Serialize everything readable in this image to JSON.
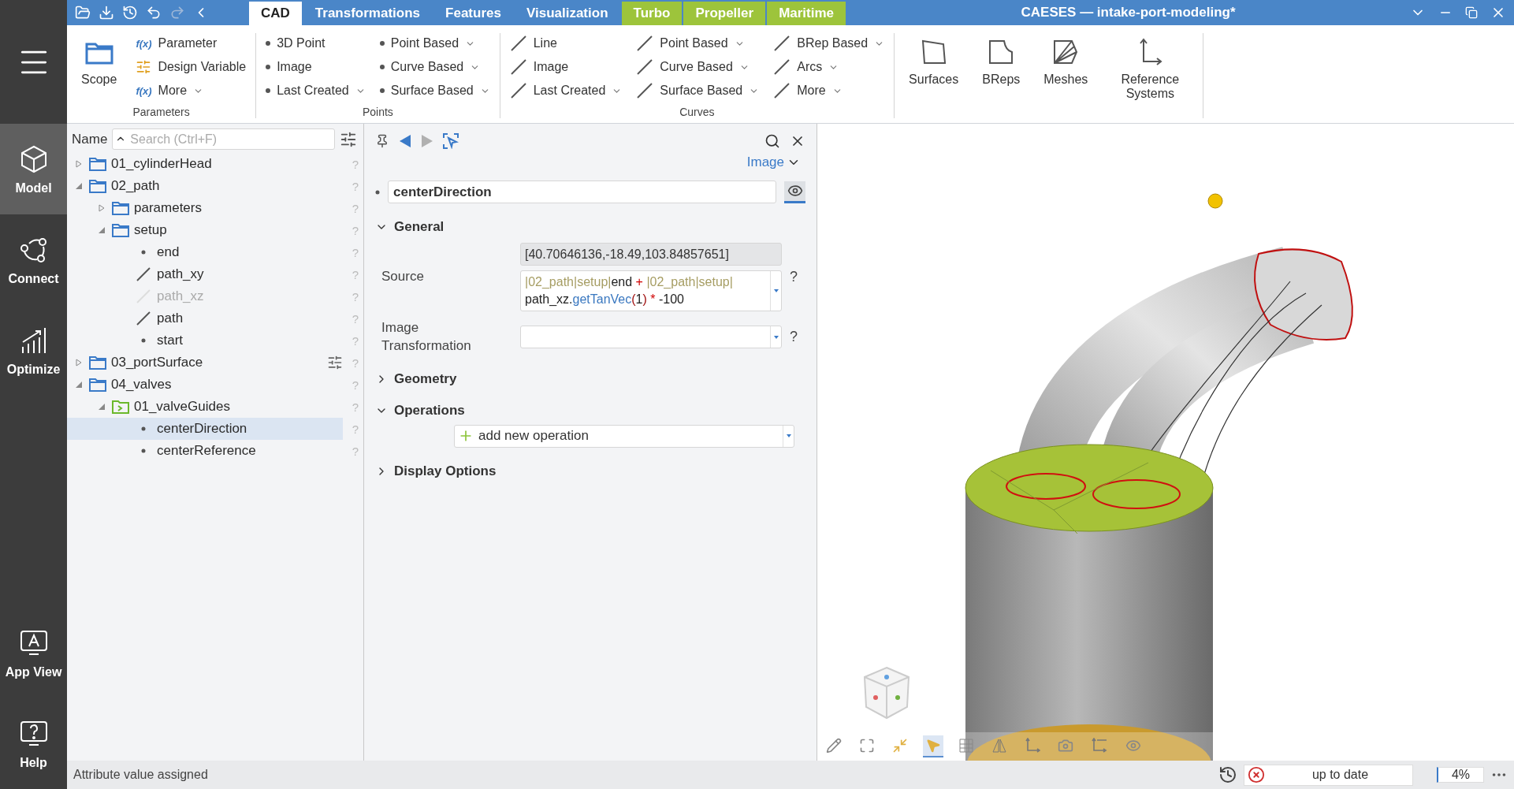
{
  "window": {
    "title": "CAESES — intake-port-modeling*"
  },
  "quick_actions": [
    {
      "kind": "open",
      "disabled": false
    },
    {
      "kind": "save",
      "disabled": false
    },
    {
      "kind": "history",
      "disabled": false
    },
    {
      "kind": "undo",
      "disabled": false
    },
    {
      "kind": "redo",
      "disabled": true
    },
    {
      "kind": "back",
      "disabled": false
    }
  ],
  "tabs": [
    {
      "label": "CAD",
      "selected": true,
      "kind": "core"
    },
    {
      "label": "Transformations",
      "selected": false,
      "kind": "core"
    },
    {
      "label": "Features",
      "selected": false,
      "kind": "core"
    },
    {
      "label": "Visualization",
      "selected": false,
      "kind": "core"
    },
    {
      "label": "Turbo",
      "selected": false,
      "kind": "addon"
    },
    {
      "label": "Propeller",
      "selected": false,
      "kind": "addon"
    },
    {
      "label": "Maritime",
      "selected": false,
      "kind": "addon"
    }
  ],
  "ribbon_groups": [
    {
      "label": "Parameters",
      "large": [
        {
          "label": "Scope",
          "kind": "folder"
        }
      ],
      "columns": [
        [
          {
            "label": "Parameter",
            "kind": "function",
            "prefix": "f(x)",
            "dropdown": false
          },
          {
            "label": "Design Variable",
            "kind": "slider",
            "dropdown": false
          },
          {
            "label": "More",
            "kind": "function",
            "prefix": "f(x)",
            "dropdown": true
          }
        ]
      ]
    },
    {
      "label": "Points",
      "columns": [
        [
          {
            "label": "3D Point",
            "kind": "point",
            "dropdown": false
          },
          {
            "label": "Image",
            "kind": "point",
            "dropdown": false
          },
          {
            "label": "Last Created",
            "kind": "point",
            "dropdown": true
          }
        ],
        [
          {
            "label": "Point Based",
            "kind": "point",
            "dropdown": true
          },
          {
            "label": "Curve Based",
            "kind": "point",
            "dropdown": true
          },
          {
            "label": "Surface Based",
            "kind": "point",
            "dropdown": true
          }
        ]
      ]
    },
    {
      "label": "Curves",
      "columns": [
        [
          {
            "label": "Line",
            "kind": "line",
            "dropdown": false
          },
          {
            "label": "Image",
            "kind": "line",
            "dropdown": false
          },
          {
            "label": "Last Created",
            "kind": "line",
            "dropdown": true
          }
        ],
        [
          {
            "label": "Point Based",
            "kind": "line",
            "dropdown": true
          },
          {
            "label": "Curve Based",
            "kind": "line",
            "dropdown": true
          },
          {
            "label": "Surface Based",
            "kind": "line",
            "dropdown": true
          }
        ],
        [
          {
            "label": "BRep Based",
            "kind": "line",
            "dropdown": true
          },
          {
            "label": "Arcs",
            "kind": "line",
            "dropdown": true
          },
          {
            "label": "More",
            "kind": "line",
            "dropdown": true
          }
        ]
      ]
    },
    {
      "large": [
        {
          "label": "Surfaces",
          "kind": "surface"
        },
        {
          "label": "BReps",
          "kind": "brep"
        },
        {
          "label": "Meshes",
          "kind": "mesh"
        },
        {
          "label": "Reference Systems",
          "kind": "axes"
        }
      ]
    }
  ],
  "nav_top": [
    {
      "label": "Model",
      "kind": "cube",
      "selected": true
    },
    {
      "label": "Connect",
      "kind": "network",
      "selected": false
    },
    {
      "label": "Optimize",
      "kind": "chart",
      "selected": false
    }
  ],
  "nav_bottom": [
    {
      "label": "App View",
      "kind": "appview",
      "selected": false
    },
    {
      "label": "Help",
      "kind": "help",
      "selected": false
    }
  ],
  "tree": {
    "header": "Name",
    "search_placeholder": "Search (Ctrl+F)",
    "items": [
      {
        "label": "01_cylinderHead",
        "kind": "folder",
        "expanded": false,
        "selected": false,
        "help": "?"
      },
      {
        "label": "02_path",
        "kind": "folder",
        "expanded": true,
        "selected": false,
        "help": "?",
        "children": [
          {
            "label": "parameters",
            "kind": "folder",
            "expanded": false,
            "selected": false,
            "help": "?"
          },
          {
            "label": "setup",
            "kind": "folder",
            "expanded": true,
            "selected": false,
            "help": "?",
            "children": [
              {
                "label": "end",
                "kind": "point",
                "selected": false,
                "disabled": false,
                "help": "?"
              },
              {
                "label": "path_xy",
                "kind": "curve",
                "selected": false,
                "disabled": false,
                "help": "?"
              },
              {
                "label": "path_xz",
                "kind": "curve",
                "selected": false,
                "disabled": true,
                "help": "?"
              },
              {
                "label": "path",
                "kind": "curve",
                "selected": false,
                "disabled": false,
                "help": "?"
              },
              {
                "label": "start",
                "kind": "point",
                "selected": false,
                "disabled": false,
                "help": "?"
              }
            ]
          }
        ]
      },
      {
        "label": "03_portSurface",
        "kind": "folder",
        "expanded": false,
        "selected": false,
        "parameters": true,
        "help": "?"
      },
      {
        "label": "04_valves",
        "kind": "folder",
        "expanded": true,
        "selected": false,
        "help": "?",
        "children": [
          {
            "label": "01_valveGuides",
            "kind": "script-folder",
            "expanded": true,
            "selected": false,
            "help": "?",
            "children": [
              {
                "label": "centerDirection",
                "kind": "point",
                "selected": true,
                "disabled": false,
                "help": "?"
              },
              {
                "label": "centerReference",
                "kind": "point",
                "selected": false,
                "disabled": false,
                "help": "?"
              }
            ]
          }
        ]
      }
    ]
  },
  "properties": {
    "toolbar": [
      {
        "kind": "pin",
        "disabled": false
      },
      {
        "kind": "back",
        "disabled": false
      },
      {
        "kind": "forward",
        "disabled": true
      },
      {
        "kind": "select",
        "disabled": false
      }
    ],
    "type_menu": "Image",
    "name": "centerDirection",
    "visible": true,
    "sections": [
      {
        "title": "General",
        "expanded": true,
        "kind": "attributes",
        "rows": [
          {
            "label": "Source",
            "value": "[40.70646136,-18.49,103.84857651]",
            "help": "?",
            "expression": [
              [
                {
                  "text": "|02_path|setup|",
                  "kind": "path"
                },
                {
                  "text": "end",
                  "kind": "name"
                },
                {
                  "text": " + ",
                  "kind": "op"
                },
                {
                  "text": "|02_path|setup|",
                  "kind": "path"
                }
              ],
              [
                {
                  "text": "path_xz.",
                  "kind": "name"
                },
                {
                  "text": "getTanVec",
                  "kind": "func"
                },
                {
                  "text": "(",
                  "kind": "paren"
                },
                {
                  "text": "1",
                  "kind": "name"
                },
                {
                  "text": ")",
                  "kind": "paren"
                },
                {
                  "text": " * ",
                  "kind": "op"
                },
                {
                  "text": "-100",
                  "kind": "name"
                }
              ]
            ]
          },
          {
            "label": "Image Transformation",
            "help": "?"
          }
        ]
      },
      {
        "title": "Geometry",
        "expanded": false
      },
      {
        "title": "Operations",
        "expanded": true,
        "kind": "operations",
        "add_label": "add new operation"
      },
      {
        "title": "Display Options",
        "expanded": false
      }
    ]
  },
  "viewport": {
    "tools": [
      {
        "kind": "pencil",
        "selected": false
      },
      {
        "kind": "fit",
        "selected": false
      },
      {
        "kind": "shrink",
        "selected": false
      },
      {
        "kind": "select",
        "selected": true
      },
      {
        "kind": "grid",
        "selected": false
      },
      {
        "kind": "mirror",
        "selected": false
      },
      {
        "kind": "axes",
        "selected": false
      },
      {
        "kind": "camera",
        "selected": false
      },
      {
        "kind": "axes-dotted",
        "selected": false
      },
      {
        "kind": "eye",
        "selected": false
      }
    ]
  },
  "status_bar": {
    "message": "Attribute value assigned",
    "build_status": "up to date",
    "zoom": "4%"
  }
}
